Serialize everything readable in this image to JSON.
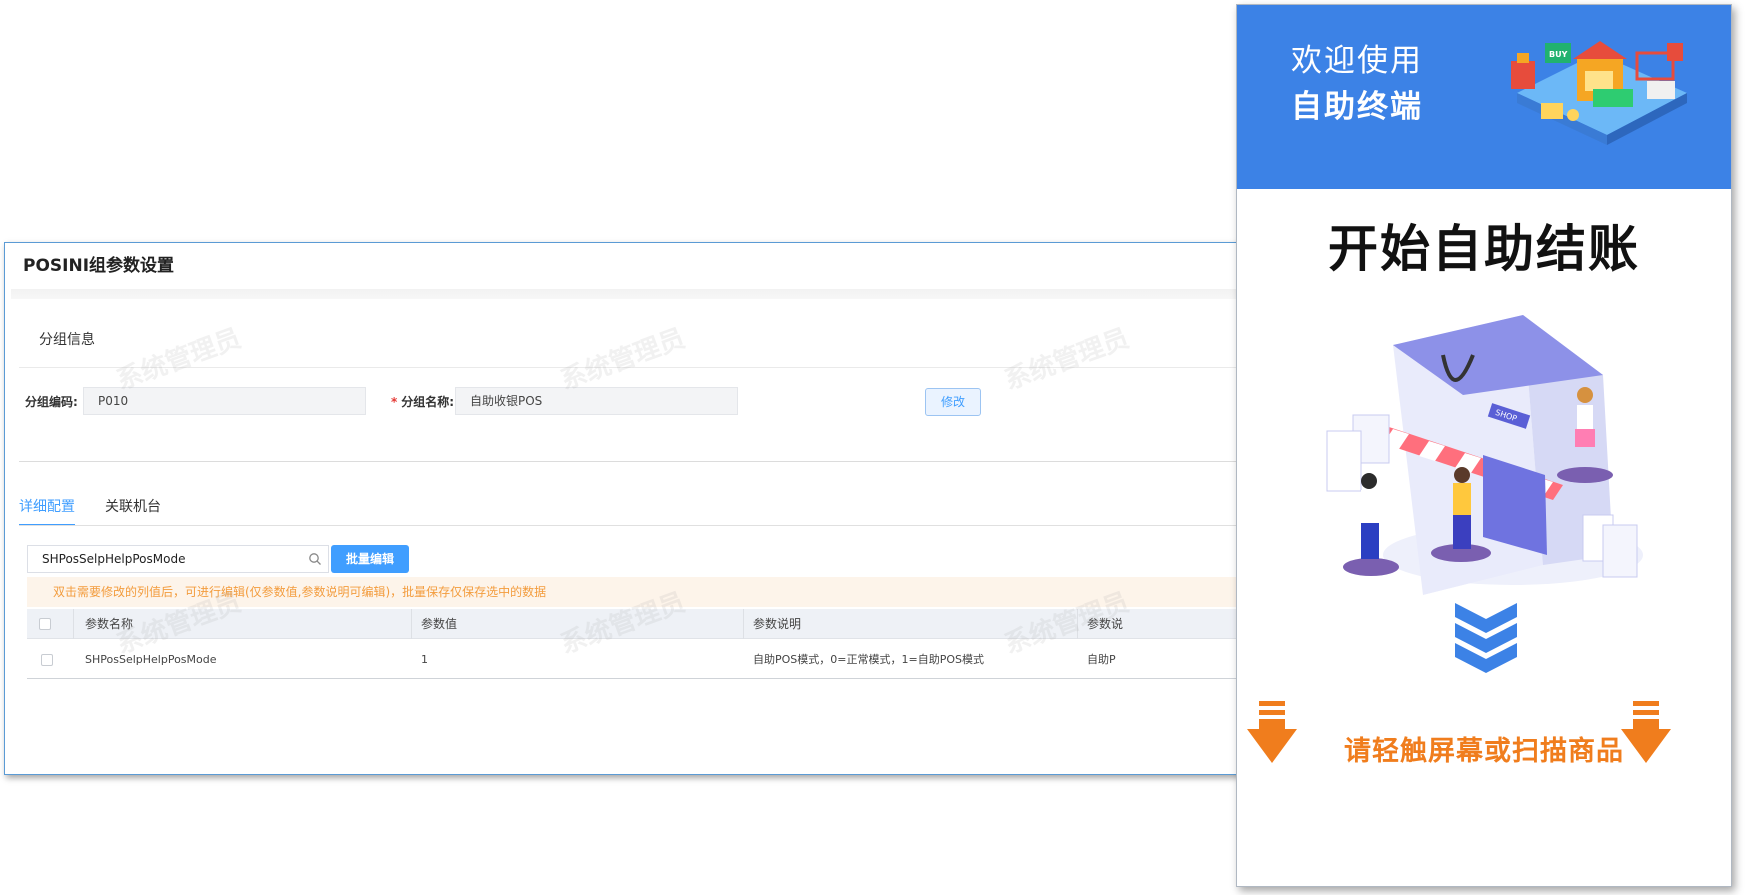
{
  "admin": {
    "title": "POSINI组参数设置",
    "group_section": "分组信息",
    "group_code_label": "分组编码:",
    "group_code_value": "P010",
    "group_name_required": "*",
    "group_name_label": "分组名称:",
    "group_name_value": "自助收银POS",
    "modify_button": "修改",
    "tabs": [
      {
        "label": "详细配置",
        "active": true
      },
      {
        "label": "关联机台",
        "active": false
      }
    ],
    "search_value": "SHPosSelpHelpPosMode",
    "batch_edit_button": "批量编辑",
    "notice": "双击需要修改的列值后，可进行编辑(仅参数值,参数说明可编辑)，批量保存仅保存选中的数据",
    "table": {
      "headers": [
        "参数名称",
        "参数值",
        "参数说明",
        "参数说"
      ],
      "rows": [
        [
          "SHPosSelpHelpPosMode",
          "1",
          "自助POS模式，0=正常模式，1=自助POS模式",
          "自助P"
        ]
      ]
    },
    "watermark": "系统管理员"
  },
  "kiosk": {
    "welcome": "欢迎使用",
    "terminal": "自助终端",
    "start_checkout": "开始自助结账",
    "hint": "请轻触屏幕或扫描商品",
    "badge_buy": "BUY",
    "sign_shop": "SHOP"
  },
  "colors": {
    "accent": "#409eff",
    "kiosk_blue": "#3c82e6",
    "hint_orange": "#f07d1d",
    "notice_bg": "#fdf4ea"
  },
  "icons": [
    "search-icon",
    "chevrons-down-icon",
    "arrow-down-icon"
  ]
}
